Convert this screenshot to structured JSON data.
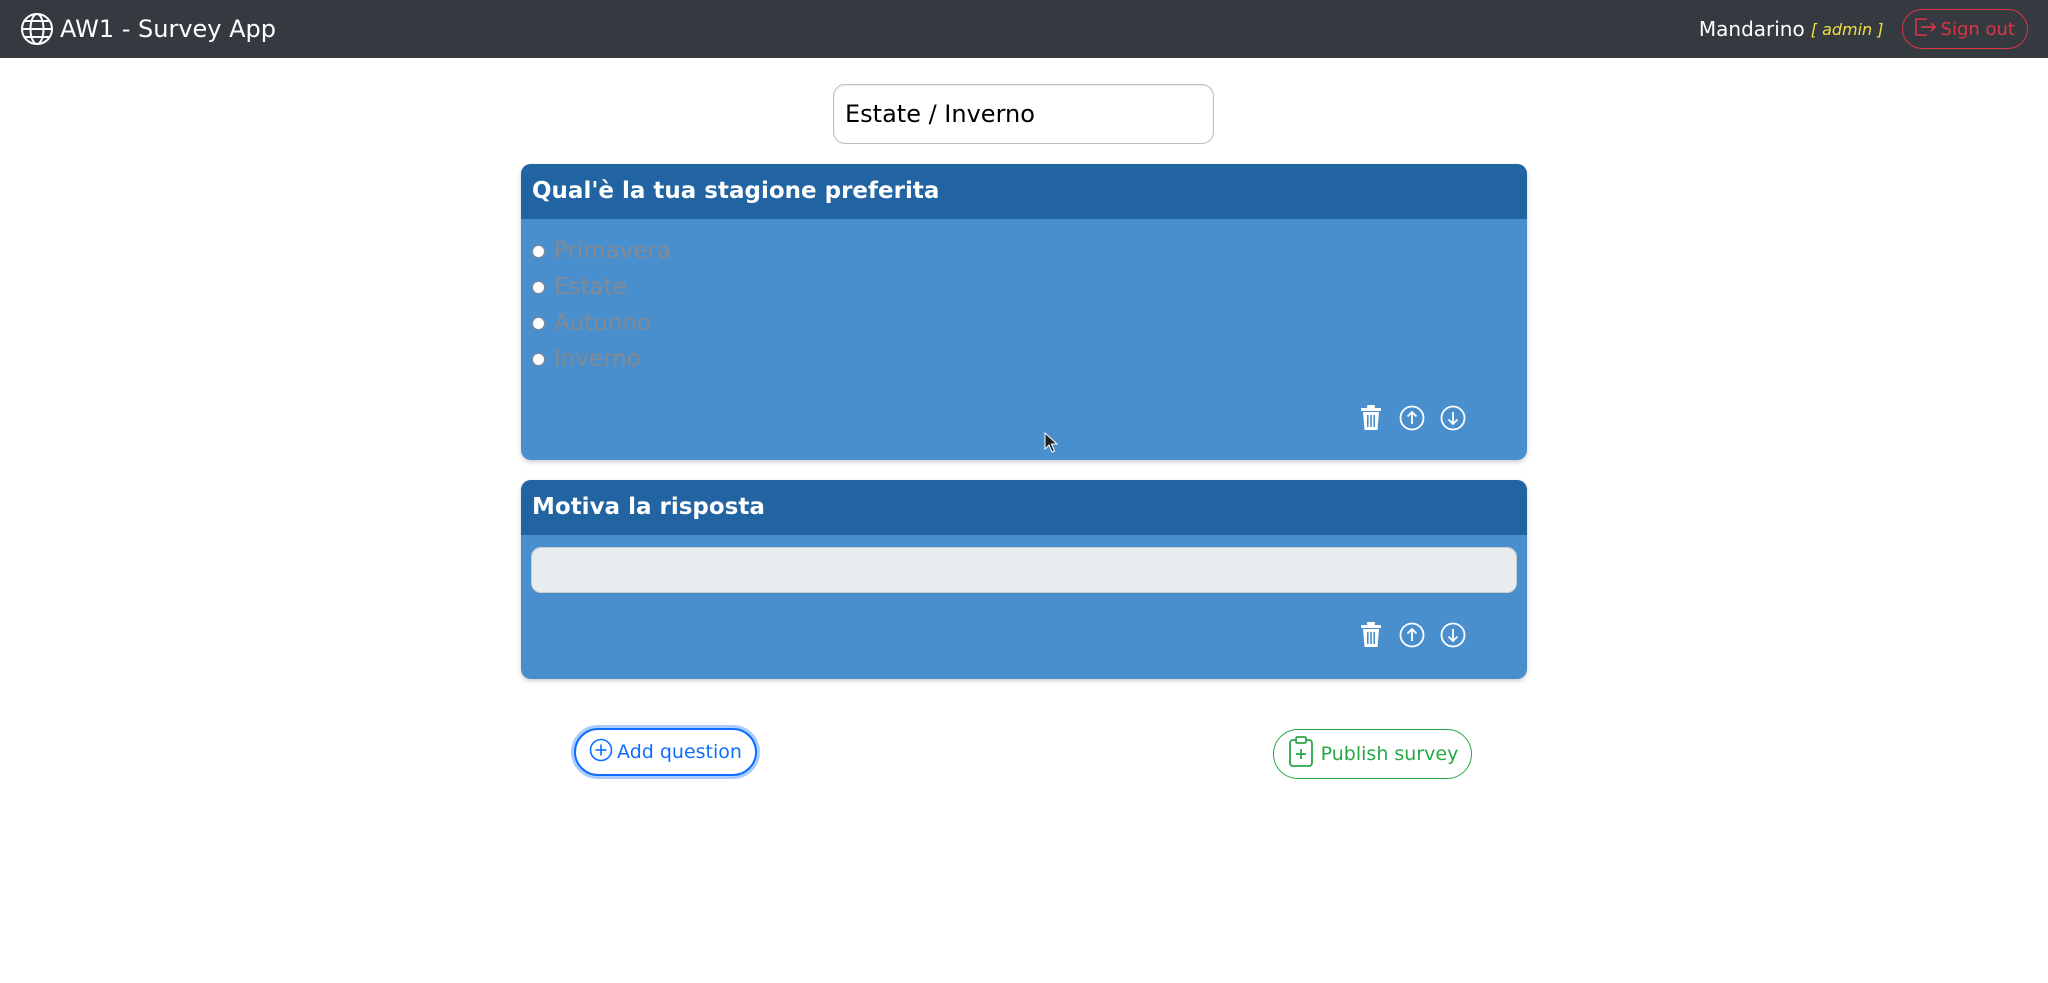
{
  "app": {
    "title": "AW1 - Survey App",
    "icon": "globe-icon"
  },
  "user": {
    "name": "Mandarino",
    "role": "[ admin ]",
    "signout_label": "Sign out"
  },
  "survey": {
    "title_value": "Estate / Inverno"
  },
  "questions": [
    {
      "title": "Qual'è la tua stagione preferita",
      "type": "closed",
      "options": [
        "Primavera",
        "Estate",
        "Autunno",
        "Inverno"
      ]
    },
    {
      "title": "Motiva la risposta",
      "type": "open",
      "answer_value": ""
    }
  ],
  "buttons": {
    "add_question": "Add question",
    "publish_survey": "Publish survey"
  },
  "colors": {
    "navbar": "#343a40",
    "card_body": "#4a8fcd",
    "card_header": "#2164a1",
    "danger": "#dc3545",
    "primary": "#0d6efd",
    "success": "#28a745",
    "role": "#f0e040"
  }
}
